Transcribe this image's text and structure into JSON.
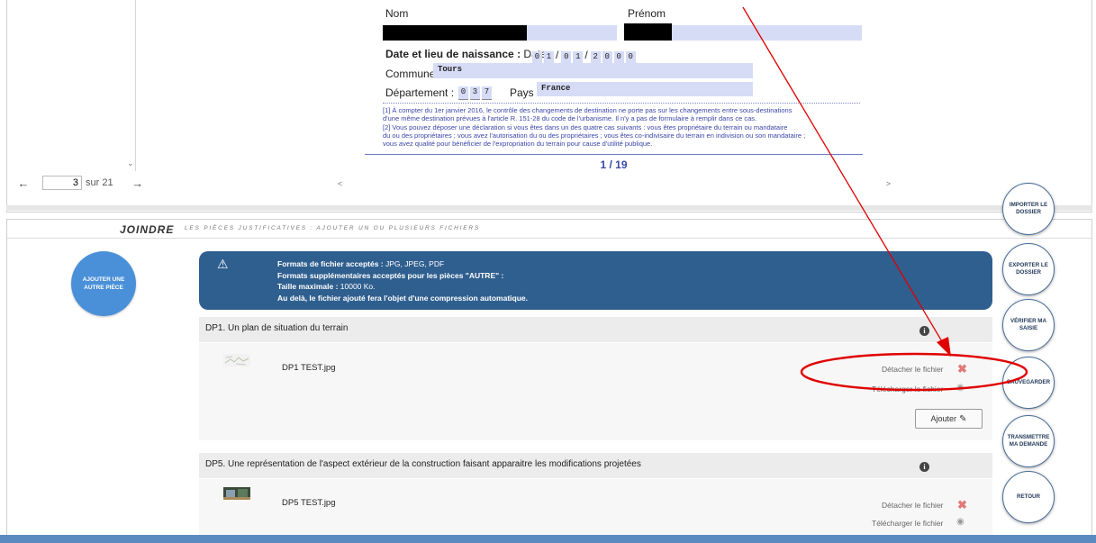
{
  "viewer": {
    "pager": {
      "prev": "←",
      "next": "→",
      "current_page": "3",
      "total": "sur 21"
    },
    "document": {
      "nom_label": "Nom",
      "prenom_label": "Prénom",
      "date_label_bold": "Date et lieu de naissance :",
      "date_label": "Date :",
      "date_digits": [
        "0",
        "1",
        "0",
        "1",
        "2",
        "0",
        "0",
        "0"
      ],
      "commune_label": "Commune :",
      "commune_value": "Tours",
      "departement_label": "Département :",
      "departement_digits": [
        "0",
        "3",
        "7"
      ],
      "pays_label": "Pays :",
      "pays_value": "France",
      "footnotes": [
        "[1] À compter du 1er janvier 2016, le contrôle des changements de destination ne porte pas sur les changements entre sous-destinations",
        "d'une même destination prévues à l'article R. 151-28 du code de l'urbanisme. Il n'y a pas de formulaire à remplir dans ce cas.",
        "[2] Vous pouvez déposer une déclaration si vous êtes dans un des quatre cas suivants : vous êtes propriétaire du terrain ou mandataire",
        "du ou des propriétaires ; vous avez l'autorisation du ou des propriétaires ; vous êtes co-indivisaire du terrain en indivision ou son mandataire ;",
        "vous avez qualité pour bénéficier de l'expropriation du terrain pour cause d'utilité publique."
      ],
      "page_indicator": "1 / 19"
    }
  },
  "joindre": {
    "title": "JOINDRE",
    "subtitle": "LES PIÈCES JUSTIFICATIVES : AJOUTER UN OU PLUSIEURS FICHIERS",
    "add_other_button": "AJOUTER UNE AUTRE PIÈCE",
    "info": {
      "icon": "warning-icon",
      "line1_bold": "Formats de fichier acceptés :",
      "line1_value": " JPG, JPEG, PDF",
      "line2_bold": "Formats supplémentaires acceptés pour les pièces \"AUTRE\" :",
      "line3_bold": "Taille maximale :",
      "line3_value": " 10000 Ko.",
      "line4_bold": "Au delà, le fichier ajouté fera l'objet d'une compression automatique."
    },
    "pieces": [
      {
        "title": "DP1. Un plan de situation du terrain",
        "file": "DP1 TEST.jpg",
        "detach": "Détacher le fichier",
        "download": "Télécharger le fichier",
        "add_button": "Ajouter"
      },
      {
        "title": "DP5. Une représentation de l'aspect extérieur de la construction faisant apparaitre les modifications projetées",
        "file": "DP5 TEST.jpg",
        "detach": "Détacher le fichier",
        "download": "Télécharger le fichier"
      }
    ]
  },
  "side_buttons": [
    "IMPORTER LE DOSSIER",
    "EXPORTER LE DOSSIER",
    "VÉRIFIER MA SAISIE",
    "SAUVEGARDER",
    "TRANSMETTRE MA DEMANDE",
    "RETOUR"
  ],
  "colors": {
    "banner": "#2f5f8f",
    "add_button": "#4a90d9",
    "annotation": "#e00000",
    "bottom_bar": "#5b8ac1"
  }
}
